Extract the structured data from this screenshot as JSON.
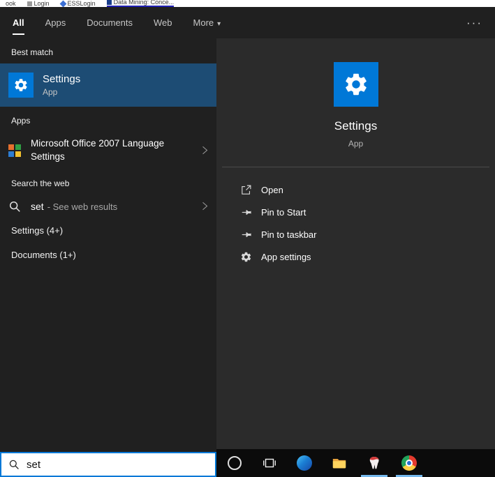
{
  "colors": {
    "accent": "#0078d7",
    "best_match_highlight": "#1d4c74",
    "left_panel_bg": "#202020",
    "right_panel_bg": "#2b2b2b",
    "taskbar_bg": "#0b0b0b",
    "taskbar_active_underline": "#76b9ed"
  },
  "browser_strip": {
    "items": [
      "ook",
      "Login",
      "ESSLogin",
      "Data Mining: Conce..."
    ]
  },
  "header": {
    "tabs": [
      {
        "label": "All",
        "active": true
      },
      {
        "label": "Apps",
        "active": false
      },
      {
        "label": "Documents",
        "active": false
      },
      {
        "label": "Web",
        "active": false
      },
      {
        "label": "More",
        "active": false,
        "has_dropdown": true
      }
    ],
    "ellipsis": "···"
  },
  "left_panel": {
    "best_match_label": "Best match",
    "best_match": {
      "title": "Settings",
      "subtitle": "App",
      "icon": "settings-gear-icon"
    },
    "apps_label": "Apps",
    "office_item": "Microsoft Office 2007 Language Settings",
    "web_label": "Search the web",
    "web_query": "set",
    "web_suffix": "- See web results",
    "settings_group": "Settings (4+)",
    "documents_group": "Documents (1+)"
  },
  "preview": {
    "title": "Settings",
    "subtitle": "App",
    "tile_icon": "gear-icon",
    "actions": [
      {
        "label": "Open",
        "icon": "open-icon"
      },
      {
        "label": "Pin to Start",
        "icon": "pin-icon"
      },
      {
        "label": "Pin to taskbar",
        "icon": "pin-icon"
      },
      {
        "label": "App settings",
        "icon": "gear-icon"
      }
    ]
  },
  "search_box": {
    "value": "set",
    "icon": "search-icon"
  },
  "taskbar": {
    "icons": [
      "cortana-icon",
      "task-view-icon",
      "edge-icon",
      "file-explorer-icon",
      "red-app-icon",
      "chrome-icon"
    ],
    "active_icons": [
      "red-app-icon",
      "chrome-icon"
    ]
  }
}
